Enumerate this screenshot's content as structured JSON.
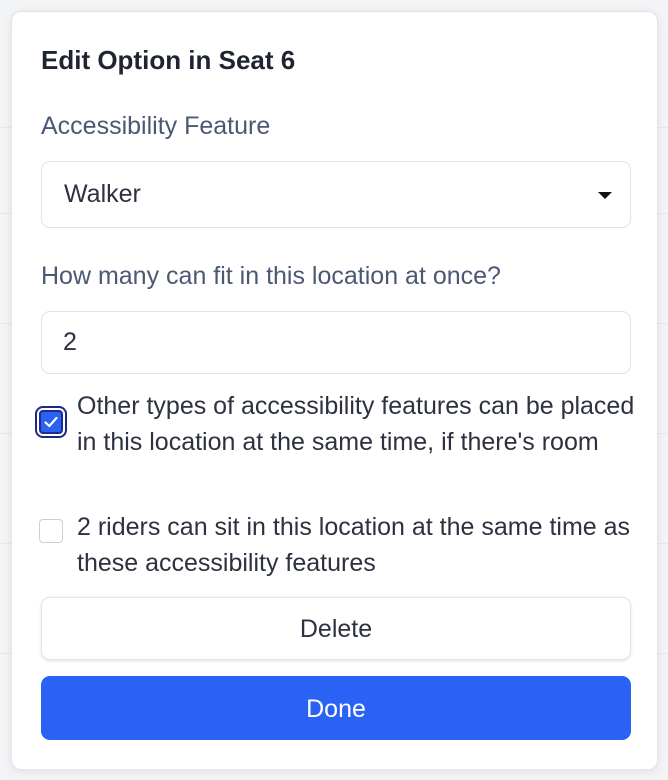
{
  "dialog": {
    "title": "Edit Option in Seat 6"
  },
  "feature_field": {
    "label": "Accessibility Feature",
    "selected_value": "Walker"
  },
  "capacity_field": {
    "label": "How many can fit in this location at once?",
    "value": "2"
  },
  "checkboxes": [
    {
      "label": "Other types of accessibility features can be placed in this location at the same time, if there's room",
      "checked": true
    },
    {
      "label": "2 riders can sit in this location at the same time as these accessibility features",
      "checked": false
    }
  ],
  "actions": {
    "delete_label": "Delete",
    "done_label": "Done"
  },
  "colors": {
    "primary": "#2a62f5",
    "label_text": "#4b5874",
    "body_text": "#2d3140"
  }
}
